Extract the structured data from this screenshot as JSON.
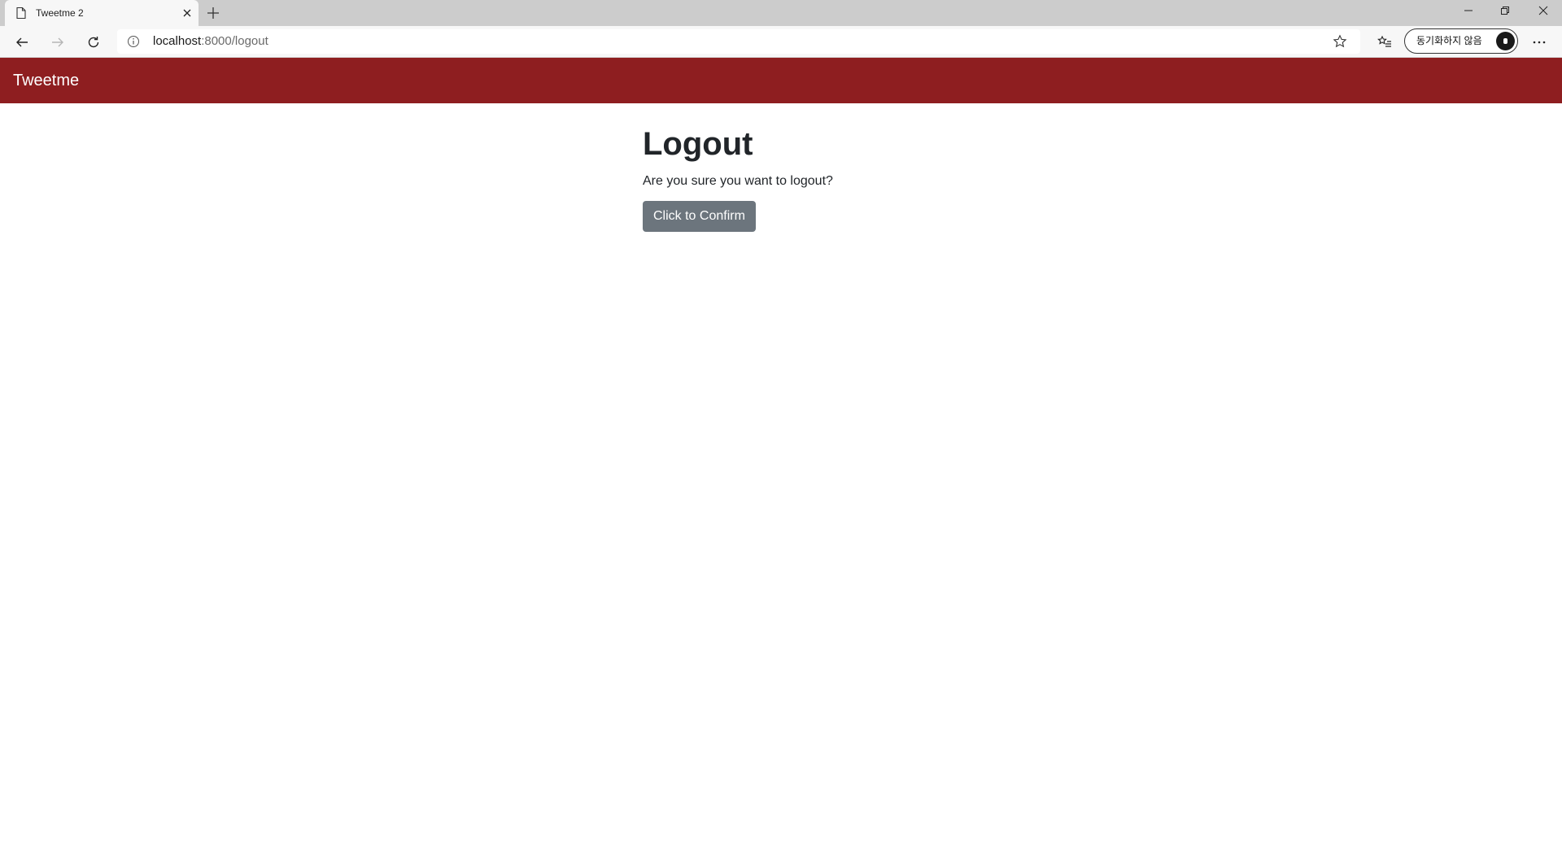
{
  "browser": {
    "tab": {
      "title": "Tweetme 2"
    },
    "address": {
      "host": "localhost",
      "path": ":8000/logout"
    },
    "sync_label": "동기화하지 않음"
  },
  "navbar": {
    "brand": "Tweetme",
    "color": "#8e1e20"
  },
  "main": {
    "title": "Logout",
    "prompt": "Are you sure you want to logout?",
    "confirm_label": "Click to Confirm"
  },
  "icons": [
    "page-icon",
    "close-icon",
    "plus-icon",
    "minimize-icon",
    "restore-icon",
    "window-close-icon",
    "back-arrow-icon",
    "forward-arrow-icon",
    "reload-icon",
    "info-icon",
    "star-icon",
    "favorites-icon",
    "avatar-icon",
    "more-icon"
  ]
}
